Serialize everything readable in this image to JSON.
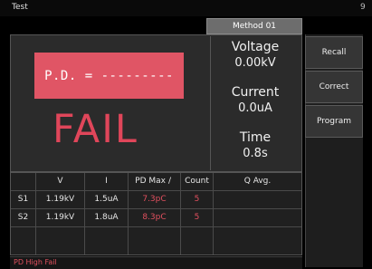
{
  "window": {
    "title": "Test",
    "corner": "9"
  },
  "method_tab": "Method 01",
  "pd_display": "P.D. = ---------",
  "result": "FAIL",
  "readouts": {
    "voltage_label": "Voltage",
    "voltage_value": "0.00kV",
    "current_label": "Current",
    "current_value": "0.0uA",
    "time_label": "Time",
    "time_value": "0.8s"
  },
  "side_buttons": [
    "Recall",
    "Correct",
    "Program"
  ],
  "table": {
    "headers": [
      "",
      "V",
      "I",
      "PD Max",
      "/",
      "Count",
      "Q Avg."
    ],
    "rows": [
      [
        "S1",
        "1.19kV",
        "1.5uA",
        "7.3pC",
        "5",
        ""
      ],
      [
        "S2",
        "1.19kV",
        "1.8uA",
        "8.3pC",
        "5",
        ""
      ]
    ]
  },
  "status": "PD High Fail",
  "colors": {
    "alert": "#e2505f",
    "pd_box": "#e05565"
  }
}
